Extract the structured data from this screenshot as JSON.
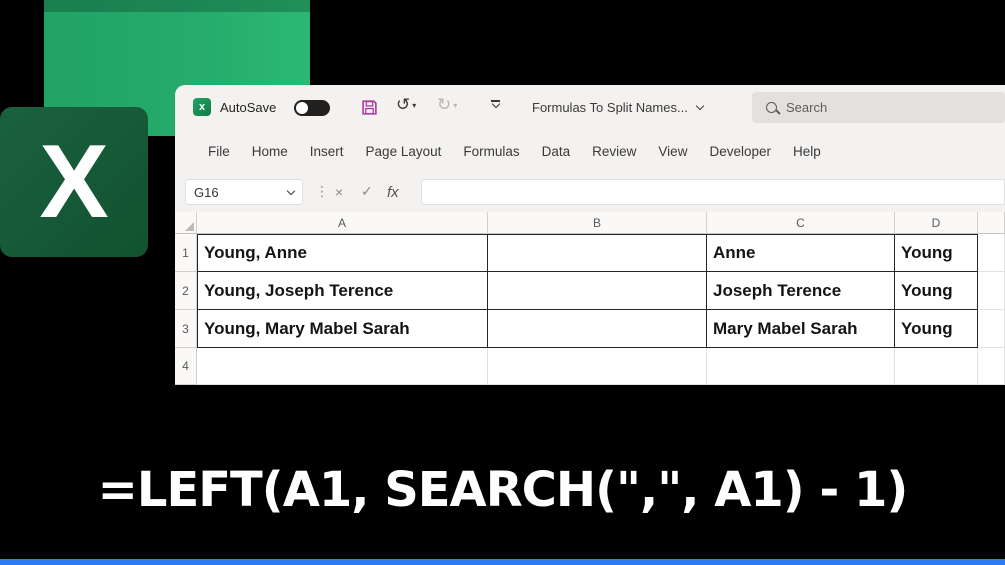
{
  "logo": {
    "letter": "X"
  },
  "titlebar": {
    "autosave_label": "AutoSave",
    "doc_title": "Formulas To Split Names...",
    "search_placeholder": "Search"
  },
  "icons": {
    "excel_small": "x",
    "undo": "↺",
    "redo": "↻",
    "caret": "▾",
    "dots": "⋮",
    "cancel": "×",
    "enter": "✓",
    "fx": "fx"
  },
  "ribbon": {
    "tabs": [
      "File",
      "Home",
      "Insert",
      "Page Layout",
      "Formulas",
      "Data",
      "Review",
      "View",
      "Developer",
      "Help"
    ]
  },
  "formula_bar": {
    "name_box_value": "G16",
    "formula_value": ""
  },
  "grid": {
    "column_headers": [
      "A",
      "B",
      "C",
      "D"
    ],
    "rows": [
      {
        "num": "1",
        "cells": {
          "a": "Young, Anne",
          "c": "Anne",
          "d": "Young"
        }
      },
      {
        "num": "2",
        "cells": {
          "a": "Young, Joseph Terence",
          "c": "Joseph Terence",
          "d": "Young"
        }
      },
      {
        "num": "3",
        "cells": {
          "a": "Young, Mary Mabel Sarah",
          "c": "Mary Mabel Sarah",
          "d": "Young"
        }
      },
      {
        "num": "4",
        "cells": {
          "a": "",
          "c": "",
          "d": ""
        }
      }
    ]
  },
  "caption": {
    "formula_text": "=LEFT(A1, SEARCH(\",\", A1) - 1)"
  },
  "colors": {
    "excel_green": "#21A366",
    "excel_dark_green": "#12522F",
    "arrow_blue": "#256E93",
    "accent_bar_blue": "#2E7BF6",
    "save_icon_purple": "#A73AA0"
  }
}
